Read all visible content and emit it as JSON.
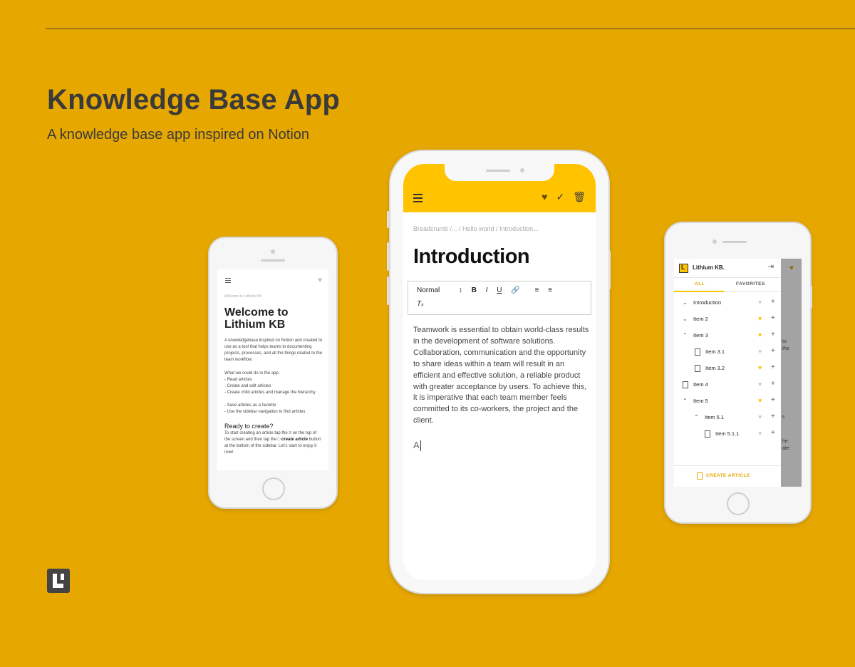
{
  "page": {
    "title": "Knowledge Base App",
    "subtitle": "A knowledge base app inspired on Notion"
  },
  "colors": {
    "background": "#E6A700",
    "accent": "#FFC300"
  },
  "left_phone": {
    "breadcrumb": "Welcome to Lithium KB",
    "heading": "Welcome to Lithium KB",
    "intro": "A knowledgebase inspired on Notion and created to use as a tool that helps teams to documenting projects, processes, and all the things related to the team workflow.",
    "list_title": "What we could do in the app:",
    "list": [
      "- Read articles",
      "- Create and edit articles",
      "- Create child articles and manage the hierarchy",
      "- Save articles as a favorite",
      "- Use the sidebar navigation to find articles"
    ],
    "ready_heading": "Ready to create?",
    "ready_text_1": "To start creating an article tap the",
    "ready_text_2": "on the top of the screen and then tap the",
    "ready_bold": "create article",
    "ready_text_3": "button at the bottom of the sidebar. Let's start to enjoy it now!"
  },
  "center_phone": {
    "breadcrumb": "Breadcrumb /... / Hello world / Introduction...",
    "heading": "Introduction",
    "format_select": "Normal",
    "toolbar_icons": [
      "bold-icon",
      "italic-icon",
      "underline-icon",
      "link-icon",
      "ordered-list-icon",
      "bullet-list-icon",
      "clear-format-icon"
    ],
    "body": "Teamwork is essential to obtain world-class results in the development of software solutions. Collaboration, communication and the opportunity to share ideas within a team will result in an efficient and effective solution, a reliable product with greater acceptance by users. To achieve this, it is imperative that each team member feels committed to its co-workers, the project and the client.",
    "typed": "A"
  },
  "right_phone": {
    "app_name": "Lithium KB.",
    "tabs": [
      "ALL",
      "FAVORITES"
    ],
    "items": [
      {
        "label": "Introduction",
        "favorite": false
      },
      {
        "label": "Item 2",
        "favorite": true
      },
      {
        "label": "Item 3",
        "favorite": true
      },
      {
        "label": "Item 3.1",
        "favorite": false
      },
      {
        "label": "Item 3.2",
        "favorite": true
      },
      {
        "label": "Item 4",
        "favorite": false
      },
      {
        "label": "Item 5",
        "favorite": true
      },
      {
        "label": "Item 5.1",
        "favorite": false
      },
      {
        "label": "Item 5.1.1",
        "favorite": false
      }
    ],
    "create_button": "CREATE ARTICLE",
    "overlay_fragments": [
      "to",
      "the",
      "s",
      "he",
      "ate"
    ]
  }
}
